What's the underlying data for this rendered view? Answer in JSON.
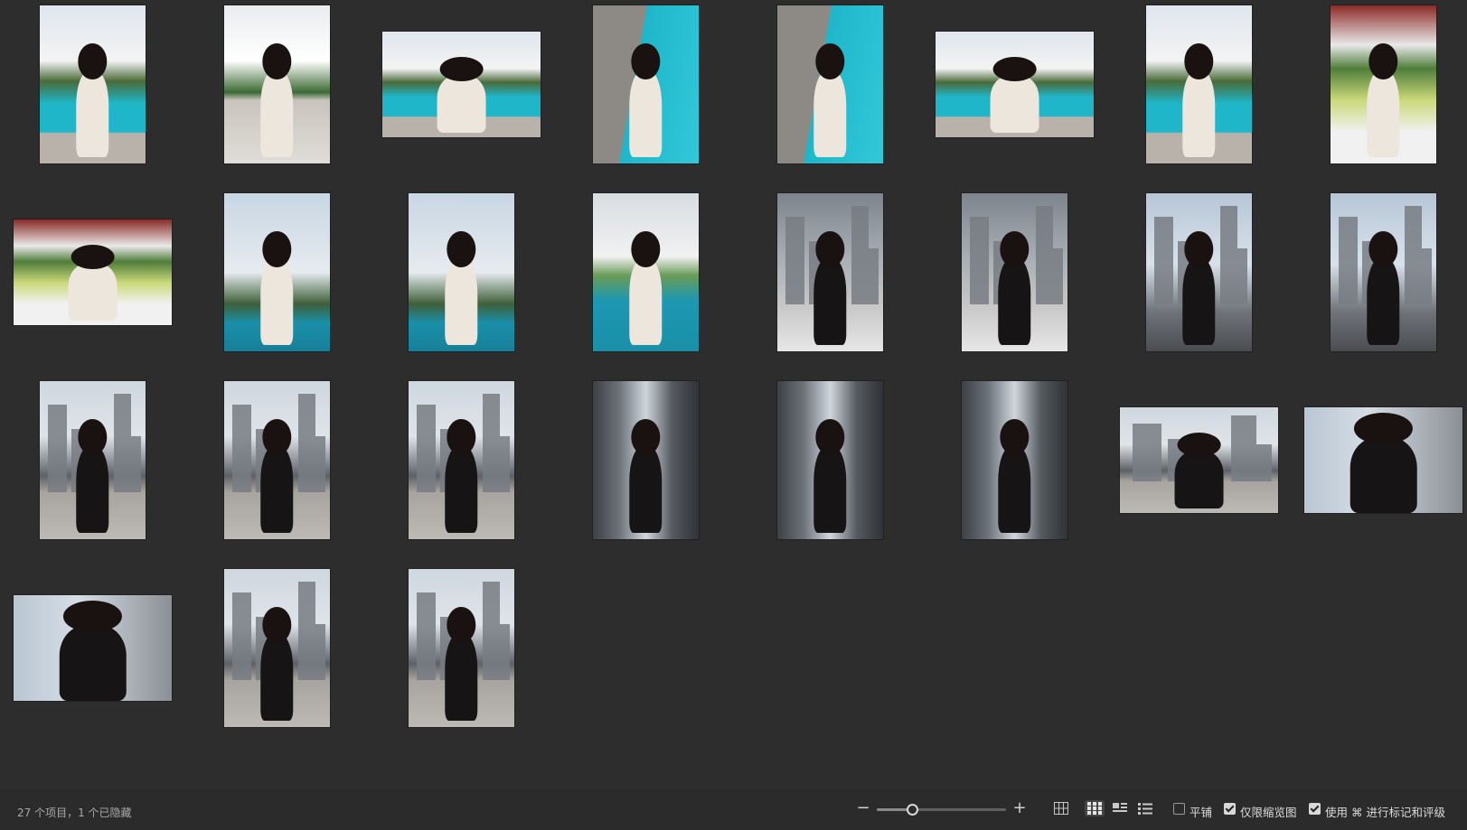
{
  "photos": [
    {
      "name": "photo-01",
      "row": 0,
      "col": 0,
      "orientation": "portrait",
      "outfit": "white",
      "scene": "pool"
    },
    {
      "name": "photo-02",
      "row": 0,
      "col": 1,
      "orientation": "portrait",
      "outfit": "white",
      "scene": "building"
    },
    {
      "name": "photo-03",
      "row": 0,
      "col": 2,
      "orientation": "landscape",
      "outfit": "white",
      "scene": "pool"
    },
    {
      "name": "photo-04",
      "row": 0,
      "col": 3,
      "orientation": "portrait",
      "outfit": "white",
      "scene": "pool-close"
    },
    {
      "name": "photo-05",
      "row": 0,
      "col": 4,
      "orientation": "portrait",
      "outfit": "white",
      "scene": "pool-close"
    },
    {
      "name": "photo-06",
      "row": 0,
      "col": 5,
      "orientation": "landscape",
      "outfit": "white",
      "scene": "pool"
    },
    {
      "name": "photo-07",
      "row": 0,
      "col": 6,
      "orientation": "portrait",
      "outfit": "white",
      "scene": "pool"
    },
    {
      "name": "photo-08",
      "row": 0,
      "col": 7,
      "orientation": "portrait",
      "outfit": "white",
      "scene": "lounge"
    },
    {
      "name": "photo-09",
      "row": 1,
      "col": 0,
      "orientation": "landscape",
      "outfit": "white",
      "scene": "lounge"
    },
    {
      "name": "photo-10",
      "row": 1,
      "col": 1,
      "orientation": "portrait",
      "outfit": "white",
      "scene": "sky-teal"
    },
    {
      "name": "photo-11",
      "row": 1,
      "col": 2,
      "orientation": "portrait",
      "outfit": "white",
      "scene": "sky-teal"
    },
    {
      "name": "photo-12",
      "row": 1,
      "col": 3,
      "orientation": "portrait",
      "outfit": "white",
      "scene": "sofa"
    },
    {
      "name": "photo-13",
      "row": 1,
      "col": 4,
      "orientation": "portrait",
      "outfit": "black",
      "scene": "city-rail"
    },
    {
      "name": "photo-14",
      "row": 1,
      "col": 5,
      "orientation": "portrait",
      "outfit": "black",
      "scene": "city-rail"
    },
    {
      "name": "photo-15",
      "row": 1,
      "col": 6,
      "orientation": "portrait",
      "outfit": "black",
      "scene": "skyline"
    },
    {
      "name": "photo-16",
      "row": 1,
      "col": 7,
      "orientation": "portrait",
      "outfit": "black",
      "scene": "skyline"
    },
    {
      "name": "photo-17",
      "row": 2,
      "col": 0,
      "orientation": "portrait",
      "outfit": "black",
      "scene": "rooftop"
    },
    {
      "name": "photo-18",
      "row": 2,
      "col": 1,
      "orientation": "portrait",
      "outfit": "black",
      "scene": "rooftop"
    },
    {
      "name": "photo-19",
      "row": 2,
      "col": 2,
      "orientation": "portrait",
      "outfit": "black",
      "scene": "rooftop"
    },
    {
      "name": "photo-20",
      "row": 2,
      "col": 3,
      "orientation": "portrait",
      "outfit": "black",
      "scene": "rooftop-dark"
    },
    {
      "name": "photo-21",
      "row": 2,
      "col": 4,
      "orientation": "portrait",
      "outfit": "black",
      "scene": "rooftop-dark"
    },
    {
      "name": "photo-22",
      "row": 2,
      "col": 5,
      "orientation": "portrait",
      "outfit": "black",
      "scene": "rooftop-dark"
    },
    {
      "name": "photo-23",
      "row": 2,
      "col": 6,
      "orientation": "landscape",
      "outfit": "black",
      "scene": "rooftop"
    },
    {
      "name": "photo-24",
      "row": 2,
      "col": 7,
      "orientation": "landscape",
      "outfit": "black",
      "scene": "portrait-close"
    },
    {
      "name": "photo-25",
      "row": 3,
      "col": 0,
      "orientation": "landscape",
      "outfit": "black",
      "scene": "portrait-close"
    },
    {
      "name": "photo-26",
      "row": 3,
      "col": 1,
      "orientation": "portrait",
      "outfit": "black",
      "scene": "rooftop"
    },
    {
      "name": "photo-27",
      "row": 3,
      "col": 2,
      "orientation": "portrait",
      "outfit": "black",
      "scene": "rooftop"
    }
  ],
  "statusbar": {
    "summary": "27 个项目，1 个已隐藏",
    "zoom_level": 0.27,
    "options": [
      {
        "label": "平铺",
        "checked": false
      },
      {
        "label": "仅限缩览图",
        "checked": true
      },
      {
        "label": "使用 ⌘ 进行标记和评级",
        "checked": true
      }
    ],
    "active_view": "grid"
  },
  "colors": {
    "background": "#2d2d2d",
    "pool": "#1fb6c9",
    "teal_sofa": "#1a8fa8",
    "sky": "#c9d6e3",
    "concrete": "#a7a39e"
  }
}
